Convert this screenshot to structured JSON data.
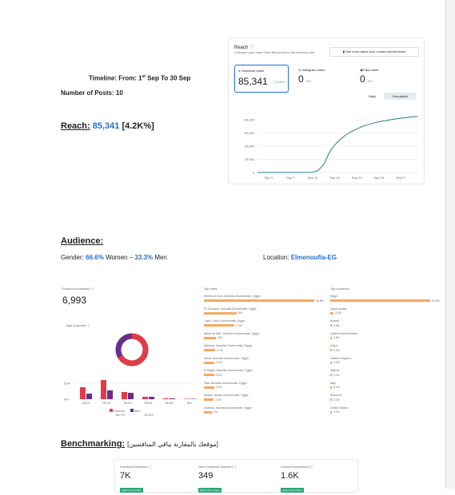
{
  "timeline": {
    "label": "Timeline: From: 1",
    "sup": "st",
    "rest": " Sep To 30 Sep"
  },
  "posts": {
    "label": "Number of Posts: 10"
  },
  "reach": {
    "label": "Reach:",
    "value": "85,341",
    "change": "[4.2K%]"
  },
  "reach_panel": {
    "title": "Reach",
    "desc": "Compare your reach from this period to the previous one.",
    "link": "See more about your content performance",
    "metrics": [
      {
        "label": "Facebook reach",
        "value": "85,341",
        "delta": "↑ 4.2K%"
      },
      {
        "label": "Instagram reach",
        "value": "0",
        "delta": "0%"
      },
      {
        "label": "Paid reach",
        "value": "0",
        "delta": "0%"
      }
    ],
    "toggle": [
      "Daily",
      "Cumulative"
    ]
  },
  "chart_data": {
    "type": "line",
    "title": "",
    "xlabel": "",
    "ylabel": "",
    "x_ticks": [
      "Sep 3",
      "Sep 7",
      "Sep 11",
      "Sep 15",
      "Sep 19",
      "Sep 23",
      "Sep 27"
    ],
    "y_ticks": [
      "80,000",
      "60,000",
      "40,000",
      "20,000",
      "0"
    ],
    "ylim": [
      0,
      85000
    ],
    "x": [
      1,
      2,
      3,
      4,
      5,
      6,
      7,
      8,
      9,
      10,
      11,
      12,
      13,
      14,
      15,
      16,
      17,
      18,
      19,
      20,
      21,
      22,
      23,
      24,
      25,
      26,
      27,
      28,
      29,
      30
    ],
    "series": [
      {
        "values": [
          0,
          0,
          0,
          0,
          0,
          0,
          0,
          0,
          0,
          0,
          500,
          3000,
          12000,
          30000,
          42000,
          50000,
          57000,
          62000,
          66000,
          70000,
          72500,
          75000,
          77000,
          78500,
          80000,
          81500,
          82500,
          83500,
          84500,
          85341
        ]
      }
    ],
    "grid": true,
    "color": "#2a7a8c"
  },
  "audience": {
    "heading": "Audience:",
    "gender_label": "Gender:",
    "women_pct": "66.6%",
    "women_text": "Women –",
    "men_pct": "33.3%",
    "men_text": "Men",
    "location_label": "Location:",
    "location_value": "Elmenoufia-EG"
  },
  "followers": {
    "label": "Facebook followers",
    "value": "6,993"
  },
  "age_gender": {
    "label": "Age & gender",
    "women_share": 0.666,
    "y_ticks": [
      "20%",
      "0%"
    ],
    "age_groups": [
      "18-24",
      "25-34",
      "35-44",
      "45-54",
      "55-64",
      "65+"
    ],
    "women": [
      15,
      24,
      9,
      3,
      1,
      0.5
    ],
    "men": [
      7,
      11,
      8,
      3,
      1,
      0.5
    ],
    "legend": [
      {
        "name": "Women",
        "value": "66.7%",
        "color": "#e03c48"
      },
      {
        "name": "Men",
        "value": "33.3%",
        "color": "#6b2d8c"
      }
    ]
  },
  "top_cities": {
    "title": "Top cities",
    "items": [
      {
        "name": "Shebin el-Kom, Monufia Governorate, Egypt",
        "pct": "26.8%",
        "value": 26.8
      },
      {
        "name": "El Shohada, Monufia Governorate, Egypt",
        "pct": "8%",
        "value": 8
      },
      {
        "name": "Cairo, Cairo Governorate, Egypt",
        "pct": "7.4%",
        "value": 7.4
      },
      {
        "name": "Birket as Sab', Monufia Governorate, Egypt",
        "pct": "3%",
        "value": 3
      },
      {
        "name": "Ashmun, Monufia Governorate, Egypt",
        "pct": "2.7%",
        "value": 2.7
      },
      {
        "name": "Minuf, Monufia Governorate, Egypt",
        "pct": "2.6%",
        "value": 2.6
      },
      {
        "name": "El Bagur, Monufia Governorate, Egypt",
        "pct": "2.5%",
        "value": 2.5
      },
      {
        "name": "Tala, Monufia Governorate, Egypt",
        "pct": "2.5%",
        "value": 2.5
      },
      {
        "name": "Aswan, Aswan Governorate, Egypt",
        "pct": "2.4%",
        "value": 2.4
      },
      {
        "name": "Quesna, Monufia Governorate, Egypt",
        "pct": "2%",
        "value": 2
      }
    ]
  },
  "top_countries": {
    "title": "Top countries",
    "items": [
      {
        "name": "Egypt",
        "pct": "92.9%",
        "value": 92.9
      },
      {
        "name": "Saudi Arabia",
        "pct": "3.2%",
        "value": 3.2
      },
      {
        "name": "Kuwait",
        "pct": "0.5%",
        "value": 0.5
      },
      {
        "name": "United Arab Emirates",
        "pct": "0.5%",
        "value": 0.5
      },
      {
        "name": "Libya",
        "pct": "0.3%",
        "value": 0.3
      },
      {
        "name": "United Kingdom",
        "pct": "0.3%",
        "value": 0.3
      },
      {
        "name": "Algeria",
        "pct": "0.2%",
        "value": 0.2
      },
      {
        "name": "Italy",
        "pct": "0.2%",
        "value": 0.2
      },
      {
        "name": "Morocco",
        "pct": "0.2%",
        "value": 0.2
      },
      {
        "name": "United States",
        "pct": "0.2%",
        "value": 0.2
      }
    ]
  },
  "benchmark": {
    "heading": "Benchmarking:",
    "arabic": "[موقعك بالمقارنة بباقي المنافسين]",
    "cards": [
      {
        "label": "Facebook followers",
        "value": "7K",
        "badge": "Higher than others"
      },
      {
        "label": "New Facebook followers",
        "value": "349",
        "badge": "Higher than others"
      },
      {
        "label": "Content interactions",
        "value": "1.6K",
        "badge": "Higher than others"
      }
    ]
  },
  "colors": {
    "accent": "#1f6fd1",
    "bar": "#f7a960",
    "line": "#2a7a8c",
    "women": "#e03c48",
    "men": "#6b2d8c"
  }
}
